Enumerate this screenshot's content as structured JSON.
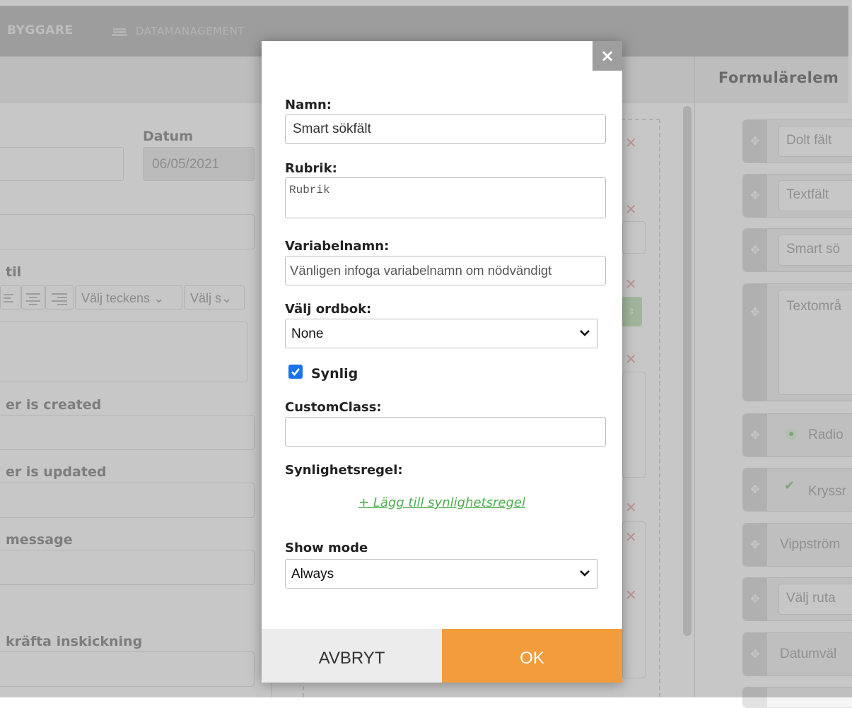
{
  "background": {
    "nav": {
      "builder": "BYGGARE",
      "datamanagement": "DATAMANAGEMENT"
    },
    "right_panel_title": "Formulärelem",
    "left_form": {
      "datum_label": "Datum",
      "datum_value": "06/05/2021",
      "stil_label": "til",
      "font_select": "Välj teckens",
      "size_select": "Välj s",
      "created_label": "er is created",
      "updated_label": "er is updated",
      "message_label": " message",
      "confirm_label": "kräfta inskickning"
    },
    "palette": [
      {
        "label": "Dolt fält"
      },
      {
        "label": "Textfält"
      },
      {
        "label": "Smart sö"
      },
      {
        "label": "Textområ"
      },
      {
        "label": "Radio"
      },
      {
        "label": "Kryssr"
      },
      {
        "label": "Vippström"
      },
      {
        "label": "Välj ruta"
      },
      {
        "label": "Datumväl"
      }
    ],
    "colors": {
      "accent_green": "#4caf50",
      "remove_red": "#f0c0bd"
    }
  },
  "modal": {
    "close_label": "×",
    "name_label": "Namn:",
    "name_value": "Smart sökfält",
    "rubrik_label": "Rubrik:",
    "rubrik_placeholder": "Rubrik",
    "variable_label": "Variabelnamn:",
    "variable_placeholder": "Vänligen infoga variabelnamn om nödvändigt",
    "dictionary_label": "Välj ordbok:",
    "dictionary_value": "None",
    "visible_label": "Synlig",
    "visible_checked": true,
    "customclass_label": "CustomClass:",
    "customclass_value": "",
    "visibility_rule_label": "Synlighetsregel:",
    "add_rule_link": "+ Lägg till synlighetsregel",
    "show_mode_label": "Show mode",
    "show_mode_value": "Always",
    "cancel_label": "AVBRYT",
    "ok_label": "OK",
    "colors": {
      "ok": "#f39c3c",
      "checkbox": "#1a73e8"
    }
  }
}
